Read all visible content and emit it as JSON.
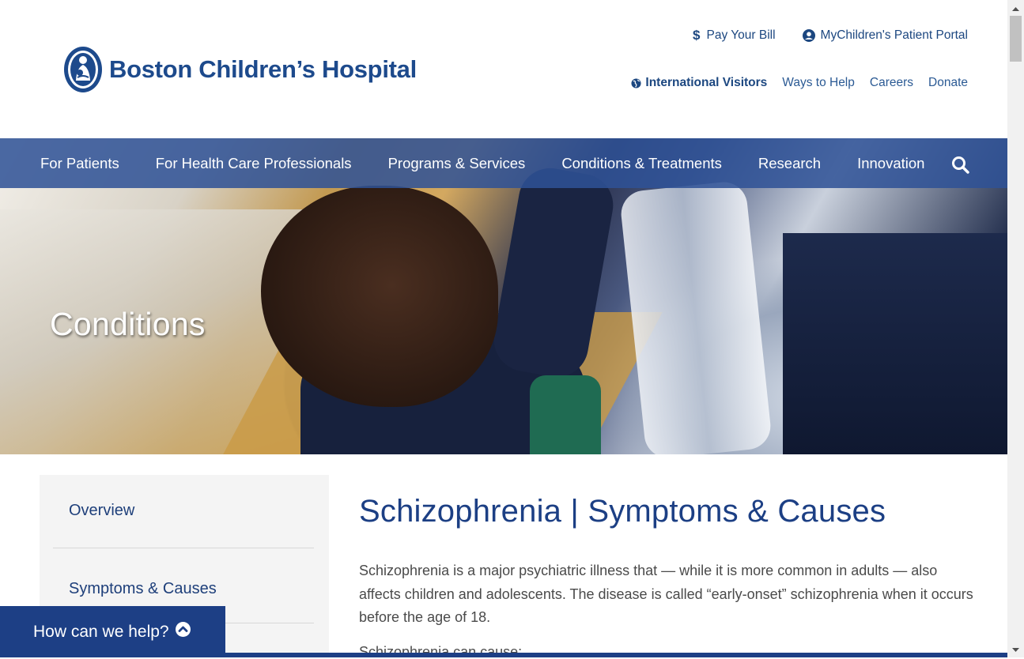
{
  "brand": {
    "name": "Boston Children’s Hospital"
  },
  "utility_links_top": [
    {
      "label": "Pay Your Bill",
      "icon": "dollar-icon"
    },
    {
      "label": "MyChildren's Patient Portal",
      "icon": "user-circle-icon"
    }
  ],
  "utility_links_bottom": [
    {
      "label": "International Visitors",
      "icon": "globe-icon"
    },
    {
      "label": "Ways to Help"
    },
    {
      "label": "Careers"
    },
    {
      "label": "Donate"
    }
  ],
  "main_nav": [
    {
      "label": "For Patients"
    },
    {
      "label": "For Health Care Professionals"
    },
    {
      "label": "Programs & Services"
    },
    {
      "label": "Conditions & Treatments"
    },
    {
      "label": "Research"
    },
    {
      "label": "Innovation"
    }
  ],
  "hero": {
    "title": "Conditions"
  },
  "sidebar": {
    "items": [
      {
        "label": "Overview"
      },
      {
        "label": "Symptoms & Causes"
      }
    ]
  },
  "content": {
    "heading": "Schizophrenia | Symptoms & Causes",
    "paragraph1": "Schizophrenia is a major psychiatric illness that — while it is more common in adults — also affects children and adolescents. The disease is called “early-onset” schizophrenia when it occurs before the age of 18.",
    "paragraph2": "Schizophrenia can cause:"
  },
  "help_widget": {
    "label": "How can we help?"
  },
  "colors": {
    "brand_navy": "#1d3f85",
    "nav_blue": "#2f5296",
    "link_blue": "#1c4780"
  }
}
